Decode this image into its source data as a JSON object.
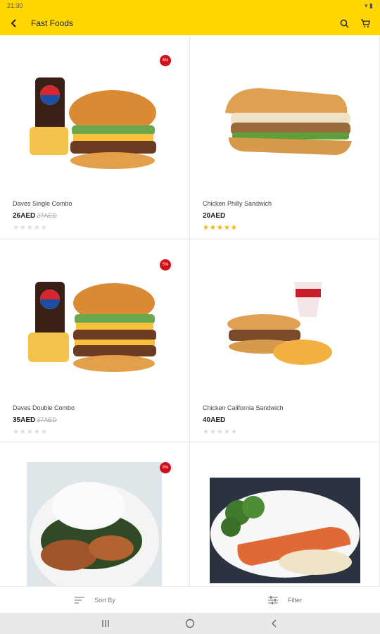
{
  "status": {
    "time": "21:30"
  },
  "header": {
    "title": "Fast Foods",
    "back_icon": "back-arrow-icon",
    "search_icon": "search-icon",
    "cart_icon": "cart-icon",
    "background": "#ffd600"
  },
  "products": [
    {
      "name": "Daves Single Combo",
      "price": "26AED",
      "old_price": "27AED",
      "badge": "4%",
      "rating": 0
    },
    {
      "name": "Chicken Philly Sandwich",
      "price": "20AED",
      "old_price": "",
      "badge": "",
      "rating": 5
    },
    {
      "name": "Daves Double Combo",
      "price": "35AED",
      "old_price": "37AED",
      "badge": "5%",
      "rating": 0
    },
    {
      "name": "Chicken California Sandwich",
      "price": "40AED",
      "old_price": "",
      "badge": "",
      "rating": 0
    },
    {
      "name": "",
      "price": "",
      "old_price": "",
      "badge": "8%",
      "rating": 0
    },
    {
      "name": "",
      "price": "",
      "old_price": "",
      "badge": "",
      "rating": 0
    }
  ],
  "stars_glyph": "★★★★★",
  "bottom": {
    "sort_label": "Sort By",
    "filter_label": "Filter"
  },
  "colors": {
    "accent": "#ffd600",
    "badge": "#d10f1b",
    "star": "#f5b400"
  }
}
